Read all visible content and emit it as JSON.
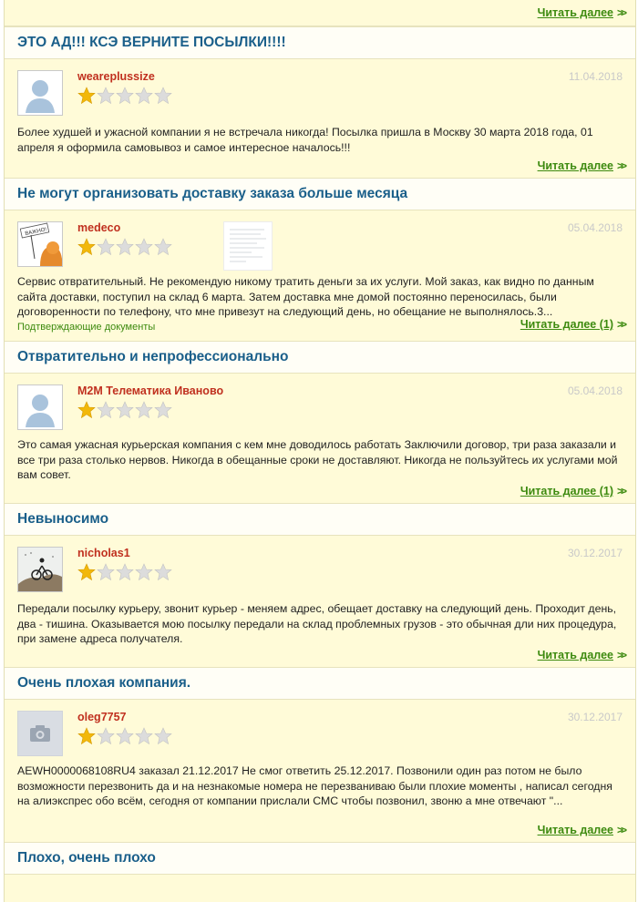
{
  "top": {
    "read_more": "Читать далее"
  },
  "reviews": [
    {
      "title": "ЭТО АД!!! КСЭ ВЕРНИТЕ ПОСЫЛКИ!!!!",
      "author": "weareplussize",
      "date": "11.04.2018",
      "rating": 1,
      "text": "Более худшей и ужасной компании я не встречала никогда! Посылка пришла в Москву 30 марта 2018 года, 01 апреля я оформила самовывоз и самое интересное началось!!!",
      "read_more": "Читать далее"
    },
    {
      "title": "Не могут организовать доставку заказа больше месяца",
      "author": "medeco",
      "date": "05.04.2018",
      "rating": 1,
      "avatar_sign": "ВАЖНО!",
      "text": "Сервис отвратительный. Не рекомендую никому тратить деньги за их услуги. Мой заказ, как видно по данным сайта доставки, поступил на склад 6 марта. Затем доставка мне домой постоянно переносилась, были договоренности по телефону, что мне привезут на следующий день, но обещание не выполнялось.3...",
      "docs_label": "Подтверждающие документы",
      "read_more": "Читать далее (1)"
    },
    {
      "title": "Отвратительно и непрофессионально",
      "author": "M2M Телематика Иваново",
      "date": "05.04.2018",
      "rating": 1,
      "text": "Это самая ужасная курьерская компания с кем мне доводилось работать Заключили договор, три раза заказали и все три раза столько нервов. Никогда в обещанные сроки не доставляют. Никогда не пользуйтесь их услугами мой вам совет.",
      "read_more": "Читать далее (1)"
    },
    {
      "title": "Невыносимо",
      "author": "nicholas1",
      "date": "30.12.2017",
      "rating": 1,
      "text": "Передали посылку курьеру, звонит курьер - меняем адрес, обещает доставку на следующий день. Проходит день, два - тишина. Оказывается мою посылку передали на склад проблемных грузов - это обычная дли них процедура, при замене адреса получателя.",
      "read_more": "Читать далее"
    },
    {
      "title": "Очень плохая компания.",
      "author": "oleg7757",
      "date": "30.12.2017",
      "rating": 1,
      "text": "AEWH0000068108RU4 заказал 21.12.2017 Не смог ответить 25.12.2017. Позвонили один раз потом не было возможности перезвонить да и на незнакомые номера не перезваниваю были плохие моменты , написал сегодня на алиэкспрес обо всём, сегодня от компании прислали СМС чтобы позвонил, звоню а мне отвечают \"...",
      "read_more": "Читать далее"
    },
    {
      "title": "Плохо, очень плохо"
    }
  ],
  "colors": {
    "title": "#1a5f8a",
    "author": "#c0301f",
    "link": "#3c8a0f",
    "body_bg": "#fffbd8",
    "star_filled": "#f2b80a",
    "star_empty": "#dcdcdc"
  }
}
